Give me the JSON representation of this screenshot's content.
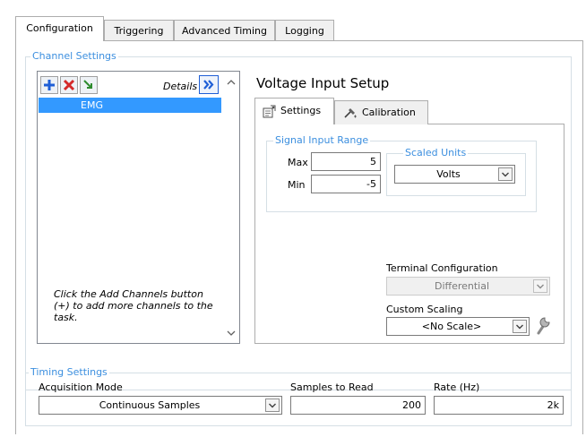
{
  "tabs": [
    "Configuration",
    "Triggering",
    "Advanced Timing",
    "Logging"
  ],
  "channel_settings": {
    "title": "Channel Settings",
    "details_label": "Details",
    "channels": [
      "EMG"
    ],
    "hint": "Click the Add Channels button (+) to add more channels to the task."
  },
  "voltage_setup": {
    "title": "Voltage Input Setup",
    "tabs": [
      "Settings",
      "Calibration"
    ],
    "signal_range": {
      "title": "Signal Input Range",
      "max_label": "Max",
      "max_value": "5",
      "min_label": "Min",
      "min_value": "-5"
    },
    "scaled_units": {
      "title": "Scaled Units",
      "value": "Volts"
    },
    "terminal_config": {
      "label": "Terminal Configuration",
      "value": "Differential"
    },
    "custom_scaling": {
      "label": "Custom Scaling",
      "value": "<No Scale>"
    }
  },
  "timing": {
    "title": "Timing Settings",
    "acq_mode_label": "Acquisition Mode",
    "acq_mode_value": "Continuous Samples",
    "samples_label": "Samples to Read",
    "samples_value": "200",
    "rate_label": "Rate (Hz)",
    "rate_value": "2k"
  },
  "colors": {
    "accent_blue": "#3c8fdf",
    "selection_blue": "#3399ff",
    "panel_border": "#adadad",
    "group_border": "#d5dfe5"
  }
}
